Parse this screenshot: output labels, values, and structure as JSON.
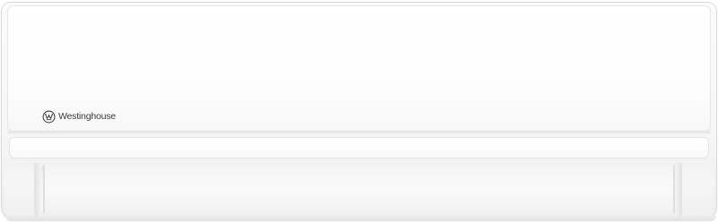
{
  "product": {
    "brand_name": "Westinghouse",
    "logo_icon": "westinghouse-w-circle-icon"
  },
  "colors": {
    "body": "#f6f6f6",
    "panel": "#ffffff",
    "logo_text": "#3a3a3a"
  }
}
